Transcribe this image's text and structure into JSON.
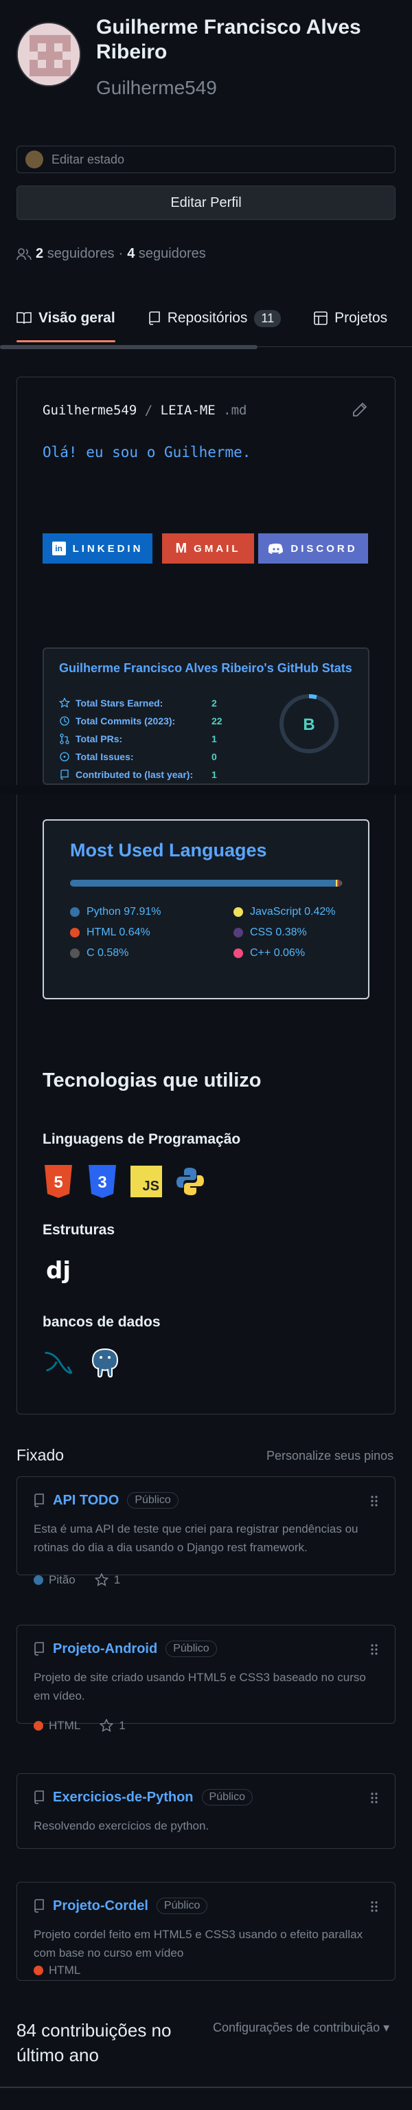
{
  "profile": {
    "name": "Guilherme Francisco Alves Ribeiro",
    "login": "Guilherme549",
    "status_placeholder": "Editar estado",
    "edit_button": "Editar Perfil",
    "followers_count": "2",
    "followers_label": "seguidores",
    "following_count": "4",
    "following_label": "seguidores",
    "separator": "·"
  },
  "tabs": [
    {
      "label": "Visão geral",
      "icon": "book-icon"
    },
    {
      "label": "Repositórios",
      "count": "11",
      "icon": "repo-icon"
    },
    {
      "label": "Projetos",
      "icon": "table-icon"
    }
  ],
  "readme": {
    "path_user": "Guilherme549",
    "path_sep": "/",
    "path_file": "LEIA-ME",
    "path_ext": ".md",
    "greeting": "Olá! eu sou o Guilherme.",
    "badges": [
      {
        "label": "LINKEDIN",
        "color": "#0a66c2"
      },
      {
        "label": "GMAIL",
        "color": "#d14836"
      },
      {
        "label": "DISCORD",
        "color": "#5a6ec7"
      }
    ],
    "stats": {
      "title": "Guilherme Francisco Alves Ribeiro's GitHub Stats",
      "rows": [
        {
          "label": "Total Stars Earned:",
          "value": "2",
          "icon": "star-icon"
        },
        {
          "label": "Total Commits (2023):",
          "value": "22",
          "icon": "history-icon"
        },
        {
          "label": "Total PRs:",
          "value": "1",
          "icon": "pr-icon"
        },
        {
          "label": "Total Issues:",
          "value": "0",
          "icon": "issue-icon"
        },
        {
          "label": "Contributed to (last year):",
          "value": "1",
          "icon": "repo-icon"
        }
      ],
      "grade": "B"
    },
    "languages": {
      "title": "Most Used Languages",
      "items": [
        {
          "name": "Python",
          "percent": "97.91%",
          "value": 97.91,
          "color": "#3572a5"
        },
        {
          "name": "JavaScript",
          "percent": "0.42%",
          "value": 0.42,
          "color": "#f1e05a"
        },
        {
          "name": "HTML",
          "percent": "0.64%",
          "value": 0.64,
          "color": "#e34c26"
        },
        {
          "name": "CSS",
          "percent": "0.38%",
          "value": 0.38,
          "color": "#563d7c"
        },
        {
          "name": "C",
          "percent": "0.58%",
          "value": 0.58,
          "color": "#555555"
        },
        {
          "name": "C++",
          "percent": "0.06%",
          "value": 0.06,
          "color": "#f34b7d"
        }
      ]
    },
    "tech": {
      "title": "Tecnologias que utilizo",
      "lang_heading": "Linguagens de Programação",
      "framework_heading": "Estruturas",
      "db_heading": "bancos de dados",
      "html5_label": "5",
      "css3_label": "3",
      "js_label": "JS",
      "django_label": "dj"
    }
  },
  "pinned": {
    "title": "Fixado",
    "customize": "Personalize seus pinos",
    "repos": [
      {
        "name": "API TODO",
        "visibility": "Público",
        "description": "Esta é uma API de teste que criei para registrar pendências ou rotinas do dia a dia usando o Django rest framework.",
        "language": "Pitão",
        "lang_color": "#3572a5",
        "stars": "1"
      },
      {
        "name": "Projeto-Android",
        "visibility": "Público",
        "description": "Projeto de site criado usando HTML5 e CSS3 baseado no curso em vídeo.",
        "language": "HTML",
        "lang_color": "#e34c26",
        "stars": "1"
      },
      {
        "name": "Exercicios-de-Python",
        "visibility": "Público",
        "description": "Resolvendo exercícios de python."
      },
      {
        "name": "Projeto-Cordel",
        "visibility": "Público",
        "description": "Projeto cordel feito em HTML5 e CSS3 usando o efeito parallax com base no curso em vídeo",
        "language": "HTML",
        "lang_color": "#e34c26"
      }
    ]
  },
  "contributions": {
    "summary": "84 contribuições no último ano",
    "settings": "Configurações de contribuição"
  }
}
